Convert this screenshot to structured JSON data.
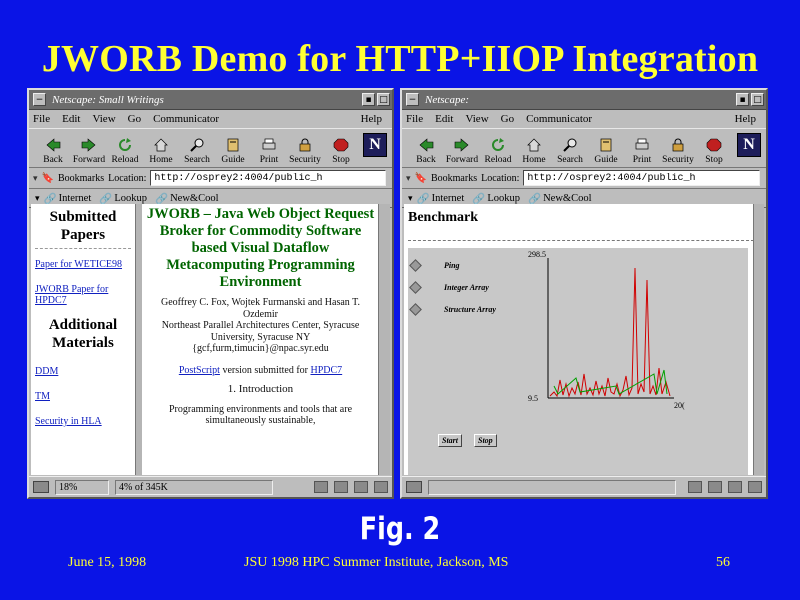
{
  "slide": {
    "title": "JWORB Demo for HTTP+IIOP Integration",
    "figure_label": "Fig. 2",
    "footer_date": "June 15,  1998",
    "footer_event": "JSU 1998 HPC Summer Institute, Jackson, MS",
    "footer_page": "56"
  },
  "left_window": {
    "title": "Netscape: Small Writings",
    "menu": [
      "File",
      "Edit",
      "View",
      "Go",
      "Communicator"
    ],
    "help": "Help",
    "toolbar": [
      "Back",
      "Forward",
      "Reload",
      "Home",
      "Search",
      "Guide",
      "Print",
      "Security",
      "Stop"
    ],
    "bookmarks_label": "Bookmarks",
    "location_label": "Location:",
    "location_value": "http://osprey2:4004/public_h",
    "personal": [
      "Internet",
      "Lookup",
      "New&Cool"
    ],
    "status_percent": "18%",
    "status_text": "4% of 345K",
    "sidebar": {
      "heading1": "Submitted Papers",
      "links1": [
        "Paper for WETICE98",
        "JWORB Paper for HPDC7"
      ],
      "heading2": "Additional Materials",
      "links2": [
        "DDM",
        "TM",
        "Security in HLA"
      ]
    },
    "doc": {
      "title": "JWORB – Java Web Object Request Broker for Commodity Software based Visual Dataflow Metacomputing Programming Environment",
      "authors": "Geoffrey C. Fox, Wojtek Furmanski and Hasan T. Ozdemir",
      "affiliation": "Northeast Parallel Architectures Center, Syracuse University, Syracuse NY",
      "email": "{gcf,furm,timucin}@npac.syr.edu",
      "postscript_link": "PostScript",
      "postscript_text": " version submitted for ",
      "hpdc_link": "HPDC7",
      "section": "1.   Introduction",
      "para": "Programming environments and tools that are simultaneously sustainable,"
    }
  },
  "right_window": {
    "title": "Netscape:",
    "menu": [
      "File",
      "Edit",
      "View",
      "Go",
      "Communicator"
    ],
    "help": "Help",
    "toolbar": [
      "Back",
      "Forward",
      "Reload",
      "Home",
      "Search",
      "Guide",
      "Print",
      "Security",
      "Stop"
    ],
    "bookmarks_label": "Bookmarks",
    "location_label": "Location:",
    "location_value": "http://osprey2:4004/public_h",
    "personal": [
      "Internet",
      "Lookup",
      "New&Cool"
    ],
    "benchmark_title": "Benchmark",
    "options": [
      "Ping",
      "Integer Array",
      "Structure Array"
    ],
    "start_button": "Start",
    "stop_button": "Stop",
    "graph": {
      "y_max_label": "298.5",
      "y_min_label": "9.5",
      "x_max_label": "20("
    }
  },
  "colors": {
    "background": "#0a14e6",
    "title_yellow": "#ffff33",
    "doc_green": "#006400",
    "plot_red": "#d00000",
    "plot_green": "#00a000"
  }
}
